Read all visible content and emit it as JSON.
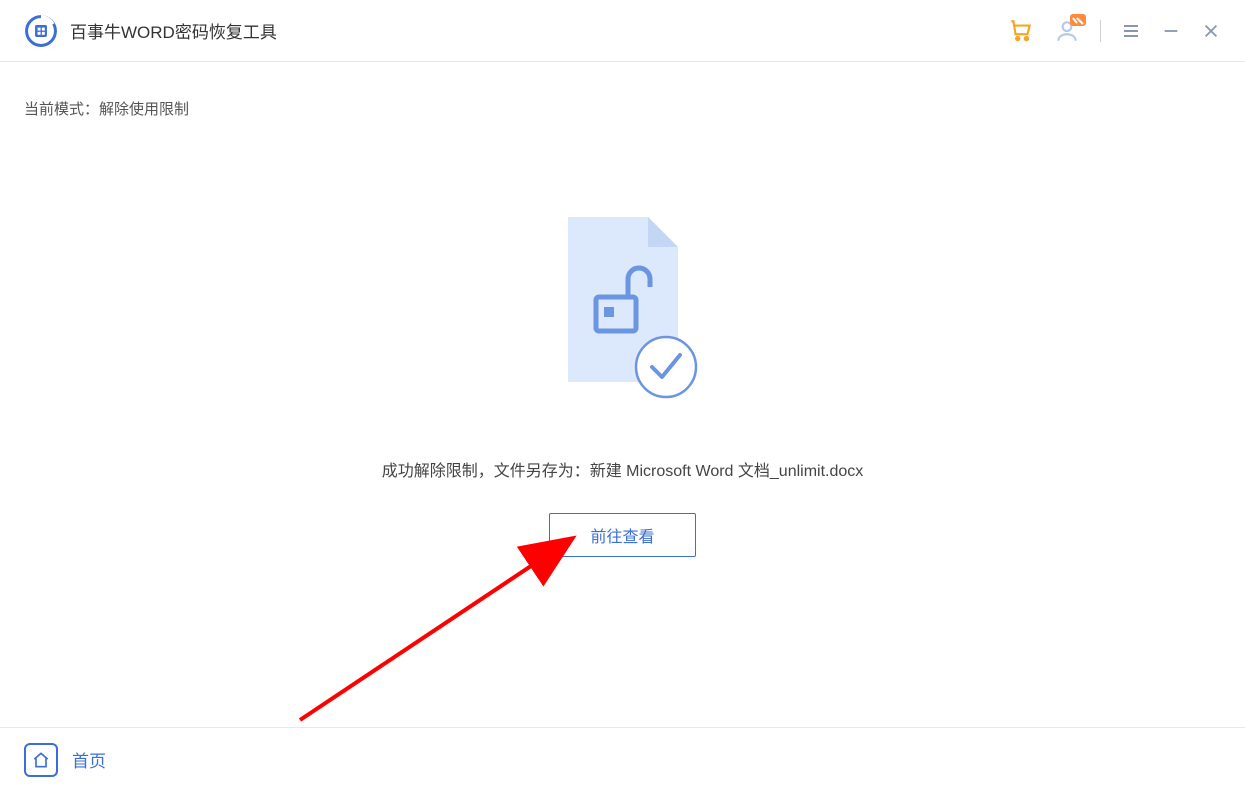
{
  "header": {
    "app_title": "百事牛WORD密码恢复工具"
  },
  "content": {
    "mode_prefix": "当前模式：",
    "mode_value": "解除使用限制",
    "status_prefix": "成功解除限制，文件另存为：",
    "saved_filename": "新建 Microsoft Word 文档_unlimit.docx",
    "view_button_label": "前往查看"
  },
  "footer": {
    "home_label": "首页"
  },
  "colors": {
    "accent": "#3b6fd6",
    "arrow": "#ff0000",
    "cart": "#f5a623",
    "badge": "#ff8a3d"
  }
}
